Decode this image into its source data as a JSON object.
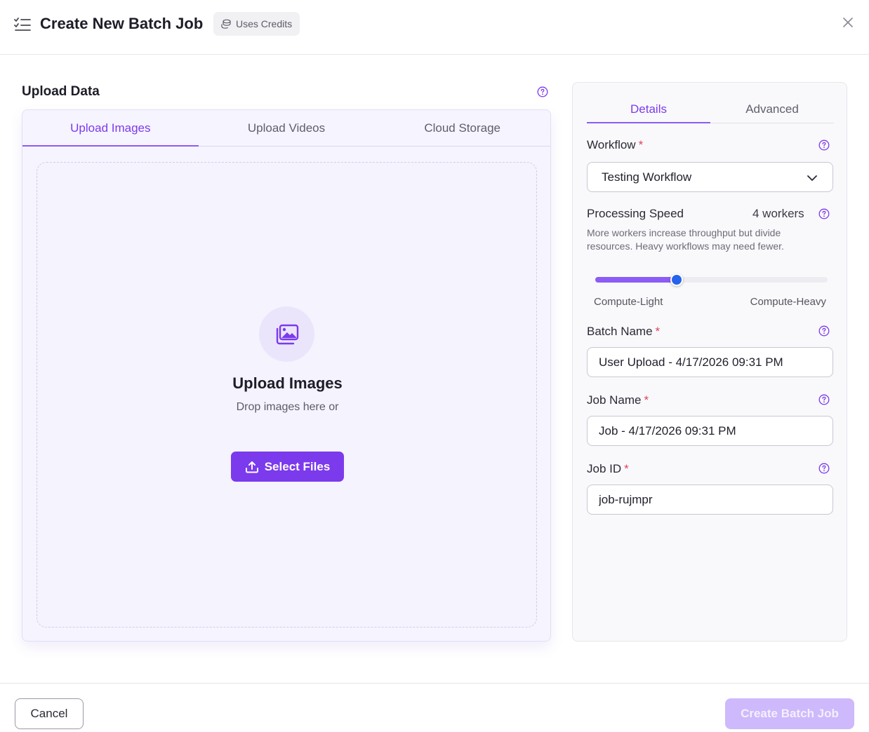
{
  "header": {
    "title": "Create New Batch Job",
    "badge": "Uses Credits",
    "icon": "list-checks-icon",
    "close_icon": "close-icon"
  },
  "upload": {
    "section_title": "Upload Data",
    "tabs": [
      {
        "label": "Upload Images",
        "active": true
      },
      {
        "label": "Upload Videos",
        "active": false
      },
      {
        "label": "Cloud Storage",
        "active": false
      }
    ],
    "dropzone": {
      "icon": "images-icon",
      "title": "Upload Images",
      "subtitle": "Drop images here or",
      "button_label": "Select Files",
      "button_icon": "upload-icon"
    }
  },
  "details": {
    "tabs": [
      {
        "label": "Details",
        "active": true
      },
      {
        "label": "Advanced",
        "active": false
      }
    ],
    "workflow": {
      "label": "Workflow",
      "required": "*",
      "value": "Testing Workflow"
    },
    "processing_speed": {
      "label": "Processing Speed",
      "workers": "4 workers",
      "description": "More workers increase throughput but divide resources. Heavy workflows may need fewer.",
      "slider_fraction": 0.35,
      "min_label": "Compute-Light",
      "max_label": "Compute-Heavy"
    },
    "batch_name": {
      "label": "Batch Name",
      "required": "*",
      "value": "User Upload - 4/17/2026 09:31 PM"
    },
    "job_name": {
      "label": "Job Name",
      "required": "*",
      "value": "Job - 4/17/2026 09:31 PM"
    },
    "job_id": {
      "label": "Job ID",
      "required": "*",
      "value": "job-rujmpr"
    }
  },
  "footer": {
    "cancel_label": "Cancel",
    "create_label": "Create Batch Job",
    "create_enabled": false
  },
  "colors": {
    "accent": "#7c3aed",
    "accent_light": "#8b5cf6",
    "slider_thumb": "#2563eb",
    "required": "#e0435a",
    "disabled_button": "#cdb9fb"
  }
}
